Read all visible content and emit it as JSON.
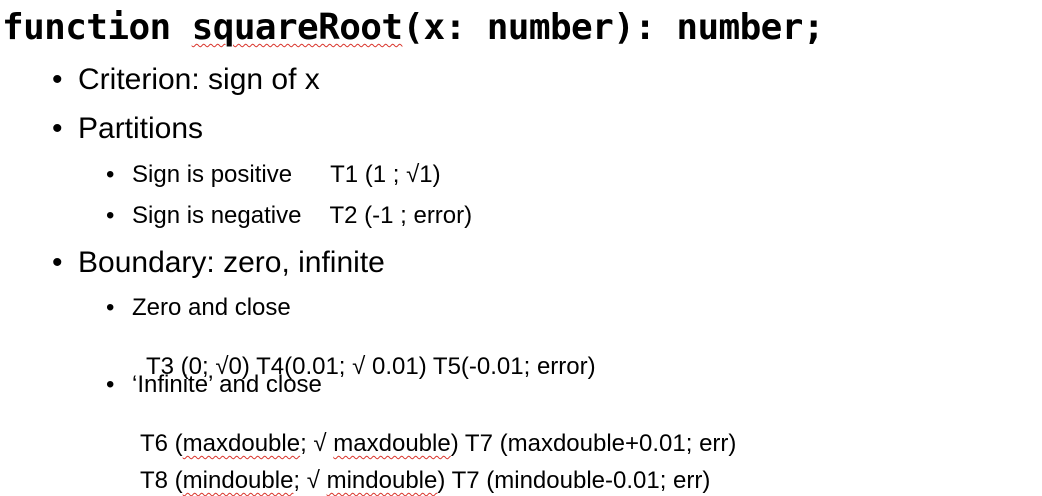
{
  "title": {
    "keyword": "function ",
    "name": "squareRoot",
    "signature": "(x: number): number;"
  },
  "bullet_char": "•",
  "criterion": "Criterion: sign of x",
  "partitions": {
    "heading": "Partitions",
    "items": [
      {
        "label": "Sign is positive",
        "test": "T1 (1 ; √1)"
      },
      {
        "label": "Sign is negative",
        "test": "T2 (-1 ; error)"
      }
    ]
  },
  "boundary": {
    "heading": "Boundary: zero, infinite",
    "zero": {
      "label": "Zero and close",
      "tests": "T3 (0; √0)  T4(0.01; √ 0.01)  T5(-0.01; error)"
    },
    "infinite": {
      "label": "‘Infinite’ and close",
      "line1": {
        "pre": "T6 (",
        "w1": "maxdouble",
        "mid": "; √ ",
        "w2": "maxdouble",
        "post": ") T7 (maxdouble+0.01; err)"
      },
      "line2": {
        "pre": "T8 (",
        "w1": "mindouble",
        "mid": "; √ ",
        "w2": "mindouble",
        "post": ") T7 (mindouble-0.01; err)"
      }
    }
  }
}
